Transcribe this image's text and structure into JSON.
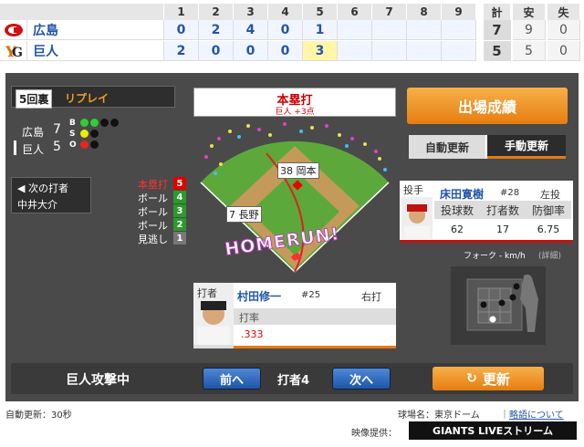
{
  "scoreboard": {
    "innings": [
      "1",
      "2",
      "3",
      "4",
      "5",
      "6",
      "7",
      "8",
      "9"
    ],
    "total_label": "計",
    "hits_label": "安",
    "errors_label": "失",
    "teams": [
      {
        "name": "広島",
        "scores": [
          "0",
          "2",
          "4",
          "0",
          "1",
          "",
          "",
          "",
          ""
        ],
        "total": "7",
        "hits": "9",
        "errors": "0",
        "color": "#d01010"
      },
      {
        "name": "巨人",
        "scores": [
          "2",
          "0",
          "0",
          "0",
          "3",
          "",
          "",
          "",
          ""
        ],
        "total": "5",
        "hits": "5",
        "errors": "0",
        "color": "#f08000"
      }
    ]
  },
  "situation": {
    "inning": "5回裏",
    "replay": "リプレイ",
    "score_rows": [
      {
        "team": "広島",
        "score": "7"
      },
      {
        "team": "巨人",
        "score": "5"
      }
    ],
    "bso_letters": [
      "B",
      "S",
      "O"
    ],
    "next_batter_label": "◀ 次の打者",
    "next_batter_name": "中井大介"
  },
  "pitches": [
    {
      "label": "本塁打",
      "count": "5",
      "color": "#e00000"
    },
    {
      "label": "ボール",
      "count": "4",
      "color": "#2a9a2a"
    },
    {
      "label": "ボール",
      "count": "3",
      "color": "#2a9a2a"
    },
    {
      "label": "ボール",
      "count": "2",
      "color": "#2a9a2a"
    },
    {
      "label": "見逃し",
      "count": "1",
      "color": "#777777"
    }
  ],
  "field": {
    "play_title": "本塁打",
    "play_sub": "巨人 +3点",
    "fielder1": "38 岡本",
    "fielder2": "7 長野",
    "homerun_text": "HOMERUN!"
  },
  "batter": {
    "role": "打者",
    "name": "村田修一",
    "number": "#25",
    "hand": "右打",
    "stat_label": "打率",
    "avg": ".333"
  },
  "right": {
    "stats_button": "出場成績",
    "auto_update": "自動更新",
    "manual_update": "手動更新"
  },
  "pitcher": {
    "role": "投手",
    "name": "床田寛樹",
    "number": "#28",
    "hand": "左投",
    "headers": [
      "投球数",
      "打者数",
      "防御率"
    ],
    "values": [
      "62",
      "17",
      "6.75"
    ],
    "pitch_info": "フォーク - km/h",
    "detail": "(詳細)"
  },
  "bottom": {
    "attacking": "巨人攻撃中",
    "prev": "前へ",
    "batter_num": "打者4",
    "next": "次へ",
    "refresh": "更新"
  },
  "footer": {
    "auto_update": "自動更新：30秒",
    "stadium_label": "球場名：東京ドーム",
    "sep": "｜",
    "abbr_link": "略語について",
    "video_label": "映像提供：",
    "giants_live": "GIANTS LIVEストリーム"
  }
}
